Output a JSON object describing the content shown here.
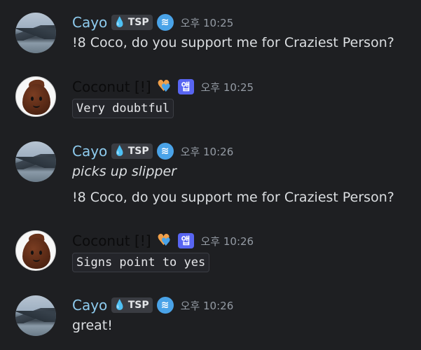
{
  "messages": [
    {
      "author": "Cayo",
      "tag": "TSP",
      "badge": "",
      "time": "오후 10:25",
      "lines": [
        "!8 Coco, do you support me for Craziest Person?"
      ]
    },
    {
      "author": "Coconut [!]",
      "app_tag": "앱",
      "time": "오후 10:25",
      "code": "Very doubtful"
    },
    {
      "author": "Cayo",
      "tag": "TSP",
      "badge": "",
      "time": "오후 10:26",
      "italic_line": "picks up slipper",
      "lines": [
        "!8 Coco, do you support me for Craziest Person?"
      ]
    },
    {
      "author": "Coconut [!]",
      "app_tag": "앱",
      "time": "오후 10:26",
      "code": "Signs point to yes"
    },
    {
      "author": "Cayo",
      "tag": "TSP",
      "badge": "",
      "time": "오후 10:26",
      "lines": [
        "great!"
      ]
    }
  ],
  "icons": {
    "tag_icon": "water-drop-icon",
    "user_badge": "wind-badge-icon",
    "bot_badge": "heart-badge-icon"
  },
  "colors": {
    "background": "#1e1f22",
    "cayo_name": "#8ecbee",
    "coconut_name": "#0b0b0c",
    "app_tag": "#5865f2",
    "timestamp": "#949ba4"
  }
}
